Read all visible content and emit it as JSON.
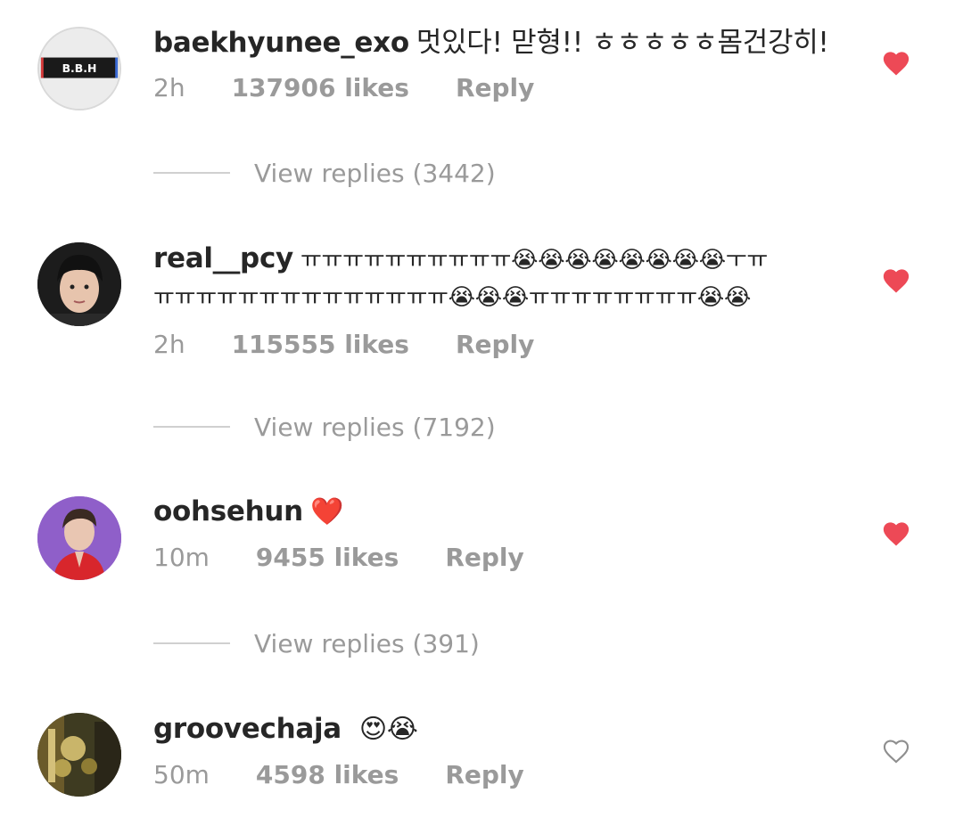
{
  "comments": [
    {
      "username": "baekhyunee_exo",
      "text": "멋있다! 맏형!! ㅎㅎㅎㅎㅎ몸건강히!",
      "time": "2h",
      "likes": "137906 likes",
      "reply": "Reply",
      "liked": true,
      "avatar_text": "B.B.H",
      "view_replies": "View replies (3442)"
    },
    {
      "username": "real__pcy",
      "text_line1": "ㅠㅠㅠㅠㅠㅠㅠㅠㅠㅠ😭😭😭😭😭😭😭😭ㅜㅠ",
      "text_line2": "ㅠㅠㅠㅠㅠㅠㅠㅠㅠㅠㅠㅠㅠㅠ😭😭😭ㅠㅠㅠㅠㅠㅠㅠㅠ😭😭",
      "time": "2h",
      "likes": "115555 likes",
      "reply": "Reply",
      "liked": true,
      "view_replies": "View replies (7192)"
    },
    {
      "username": "oohsehun",
      "text": "❤️",
      "time": "10m",
      "likes": "9455 likes",
      "reply": "Reply",
      "liked": true,
      "view_replies": "View replies (391)"
    },
    {
      "username": "groovechaja",
      "text": "😍😭",
      "time": "50m",
      "likes": "4598 likes",
      "reply": "Reply",
      "liked": false
    }
  ],
  "colors": {
    "heart_liked": "#ed4956",
    "heart_outline": "#8e8e8e",
    "meta_text": "#9a9a9a",
    "primary_text": "#262626"
  },
  "icons": {
    "heart_filled": "heart-filled-icon",
    "heart_outline": "heart-outline-icon"
  }
}
